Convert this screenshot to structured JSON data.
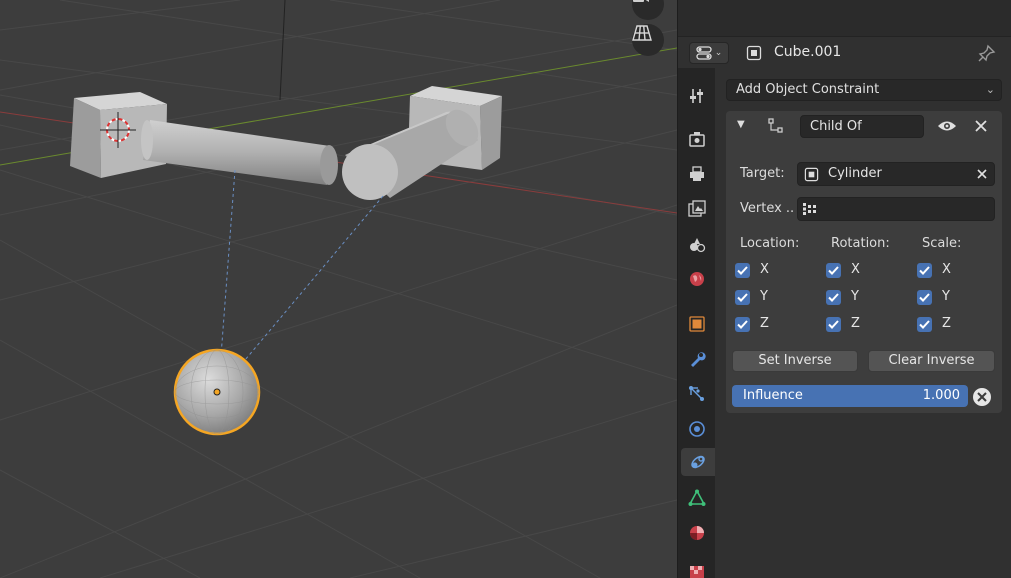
{
  "viewport": {
    "gizmos": [
      "camera-icon",
      "grid-perspective-icon"
    ]
  },
  "header": {
    "editor_type_icon": "properties-editor-icon",
    "object_name": "Cube.001",
    "pin_icon": "pin-icon"
  },
  "tabs": [
    {
      "name": "tool",
      "icon": "tool-icon"
    },
    {
      "name": "render",
      "icon": "render-icon"
    },
    {
      "name": "output",
      "icon": "output-icon"
    },
    {
      "name": "view-layer",
      "icon": "view-layer-icon"
    },
    {
      "name": "scene",
      "icon": "scene-icon"
    },
    {
      "name": "world",
      "icon": "world-icon"
    },
    {
      "name": "object",
      "icon": "object-icon"
    },
    {
      "name": "modifiers",
      "icon": "wrench-icon"
    },
    {
      "name": "particles",
      "icon": "particles-icon"
    },
    {
      "name": "physics",
      "icon": "physics-icon"
    },
    {
      "name": "constraints",
      "icon": "constraint-icon",
      "active": true
    },
    {
      "name": "data",
      "icon": "mesh-data-icon"
    },
    {
      "name": "material",
      "icon": "material-icon"
    }
  ],
  "add_constraint": {
    "label": "Add Object Constraint"
  },
  "constraint": {
    "name": "Child Of",
    "target_label": "Target:",
    "target_value": "Cylinder",
    "vertex_label": "Vertex ..",
    "vertex_value": "",
    "location_label": "Location:",
    "rotation_label": "Rotation:",
    "scale_label": "Scale:",
    "axes": [
      "X",
      "Y",
      "Z"
    ],
    "location": [
      true,
      true,
      true
    ],
    "rotation": [
      true,
      true,
      true
    ],
    "scale": [
      true,
      true,
      true
    ],
    "set_inverse_label": "Set Inverse",
    "clear_inverse_label": "Clear Inverse",
    "influence_label": "Influence",
    "influence_value": "1.000",
    "influence": 1.0
  },
  "colors": {
    "accent": "#4772b3",
    "selection": "#f5a623"
  }
}
